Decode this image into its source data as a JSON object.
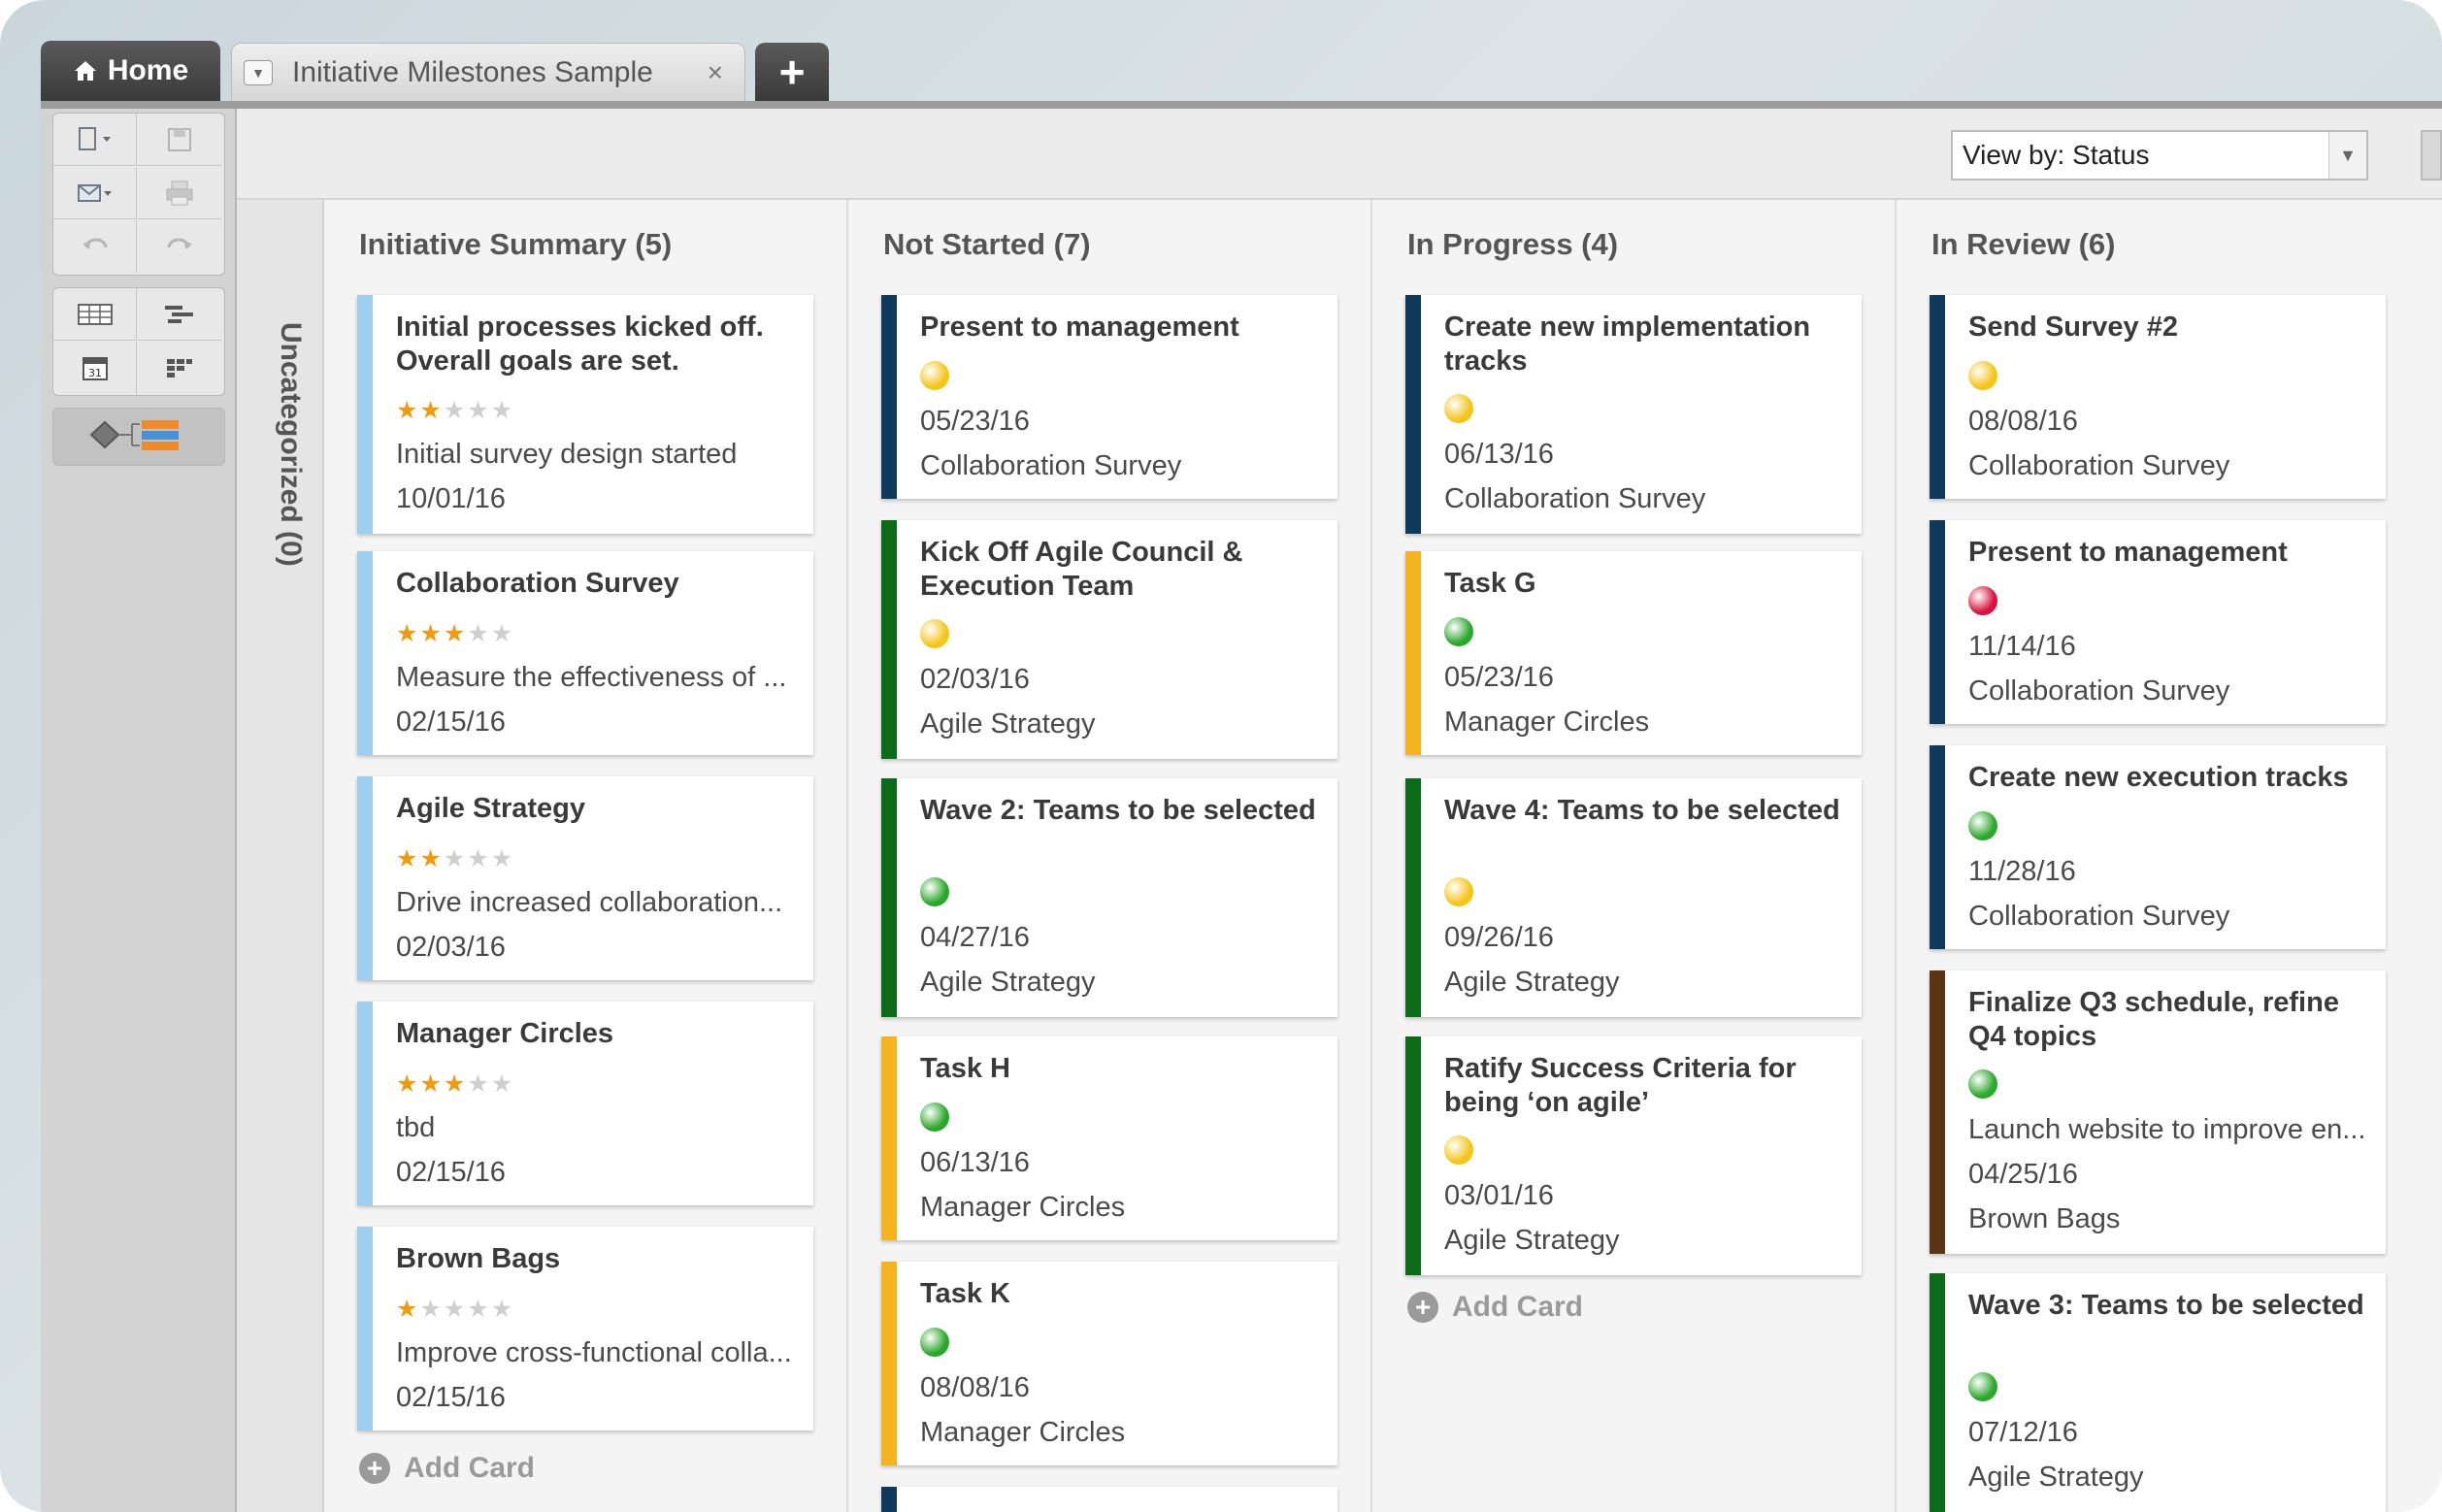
{
  "tabs": {
    "home_label": "Home",
    "doc_label": "Initiative Milestones Sample",
    "close_glyph": "×",
    "add_glyph": "+"
  },
  "view_by": {
    "label": "View by: Status"
  },
  "uncategorized": {
    "label": "Uncategorized (0)"
  },
  "add_card_label": "Add Card",
  "colors": {
    "yellow": "#f5c518",
    "green": "#2ba82b",
    "red": "#d8123a",
    "light_blue": "#9ecff0",
    "navy": "#0f3a5c",
    "dark_green": "#0c6b19",
    "orange": "#f5b322",
    "brown": "#5c3314"
  },
  "columns": [
    {
      "title": "Initiative Summary (5)",
      "cards": [
        {
          "title": "Initial processes kicked off. Overall goals are set.",
          "rating": 2,
          "desc": "Initial survey design started",
          "date": "10/01/16"
        },
        {
          "title": "Collaboration Survey",
          "rating": 3,
          "desc": "Measure the effectiveness of ...",
          "date": "02/15/16"
        },
        {
          "title": "Agile Strategy",
          "rating": 2,
          "desc": "Drive increased collaboration...",
          "date": "02/03/16"
        },
        {
          "title": "Manager Circles",
          "rating": 3,
          "desc": "tbd",
          "date": "02/15/16"
        },
        {
          "title": "Brown Bags",
          "rating": 1,
          "desc": "Improve cross-functional colla...",
          "date": "02/15/16"
        }
      ]
    },
    {
      "title": "Not Started (7)",
      "cards": [
        {
          "title": "Present to management",
          "status": "yellow",
          "date": "05/23/16",
          "project": "Collaboration Survey",
          "stripe": "navy"
        },
        {
          "title": "Kick Off Agile Council & Execution Team",
          "status": "yellow",
          "date": "02/03/16",
          "project": "Agile Strategy",
          "stripe": "dark_green"
        },
        {
          "title": "Wave 2: Teams to be selected",
          "status": "green",
          "date": "04/27/16",
          "project": "Agile Strategy",
          "stripe": "dark_green"
        },
        {
          "title": "Task H",
          "status": "green",
          "date": "06/13/16",
          "project": "Manager Circles",
          "stripe": "orange"
        },
        {
          "title": "Task K",
          "status": "green",
          "date": "08/08/16",
          "project": "Manager Circles",
          "stripe": "orange"
        }
      ]
    },
    {
      "title": "In Progress (4)",
      "cards": [
        {
          "title": "Create new implementation tracks",
          "status": "yellow",
          "date": "06/13/16",
          "project": "Collaboration Survey",
          "stripe": "navy"
        },
        {
          "title": "Task G",
          "status": "green",
          "date": "05/23/16",
          "project": "Manager Circles",
          "stripe": "orange"
        },
        {
          "title": "Wave 4: Teams to be selected",
          "status": "yellow",
          "date": "09/26/16",
          "project": "Agile Strategy",
          "stripe": "dark_green"
        },
        {
          "title": "Ratify Success Criteria for being ‘on agile’",
          "status": "yellow",
          "date": "03/01/16",
          "project": "Agile Strategy",
          "stripe": "dark_green"
        }
      ]
    },
    {
      "title": "In Review (6)",
      "cards": [
        {
          "title": "Send Survey #2",
          "status": "yellow",
          "date": "08/08/16",
          "project": "Collaboration Survey",
          "stripe": "navy"
        },
        {
          "title": "Present to management",
          "status": "red",
          "date": "11/14/16",
          "project": "Collaboration Survey",
          "stripe": "navy"
        },
        {
          "title": "Create new execution tracks",
          "status": "green",
          "date": "11/28/16",
          "project": "Collaboration Survey",
          "stripe": "navy"
        },
        {
          "title": "Finalize Q3 schedule, refine Q4 topics",
          "status": "green",
          "desc": "Launch website to improve en...",
          "date": "04/25/16",
          "project": "Brown Bags",
          "stripe": "brown"
        },
        {
          "title": "Wave 3: Teams to be selected",
          "status": "green",
          "date": "07/12/16",
          "project": "Agile Strategy",
          "stripe": "dark_green"
        }
      ]
    }
  ]
}
